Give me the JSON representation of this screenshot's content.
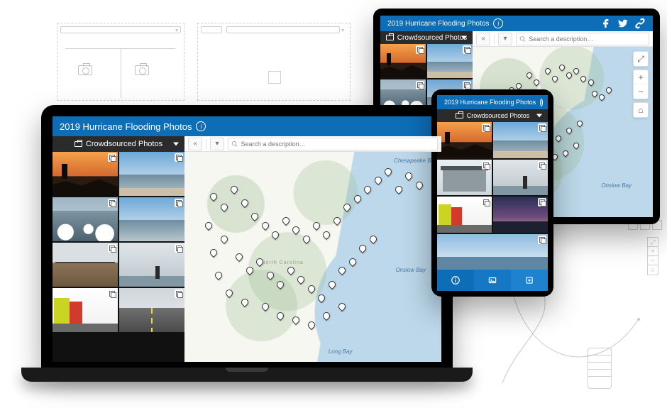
{
  "app": {
    "title": "2019 Hurricane Flooding Photos",
    "panel_label": "Crowdsourced Photos",
    "search_placeholder": "Search a description…"
  },
  "map": {
    "labels": {
      "onslow_bay": "Onslow Bay",
      "long_bay": "Long Bay",
      "chesapeake_bay": "Chesapeake Bay",
      "north_carolina": "North Carolina"
    },
    "controls": {
      "expand": "⤢",
      "zoom_in": "+",
      "zoom_out": "−",
      "home": "⌂"
    }
  },
  "header_icons": {
    "facebook": "facebook",
    "twitter": "twitter",
    "link": "link"
  },
  "phone_tabs": {
    "info": "info",
    "gallery": "gallery",
    "add": "add"
  },
  "wire": {
    "controls": {
      "expand": "⤢",
      "zoom_in": "+",
      "zoom_out": "−",
      "home": "⌂"
    }
  }
}
